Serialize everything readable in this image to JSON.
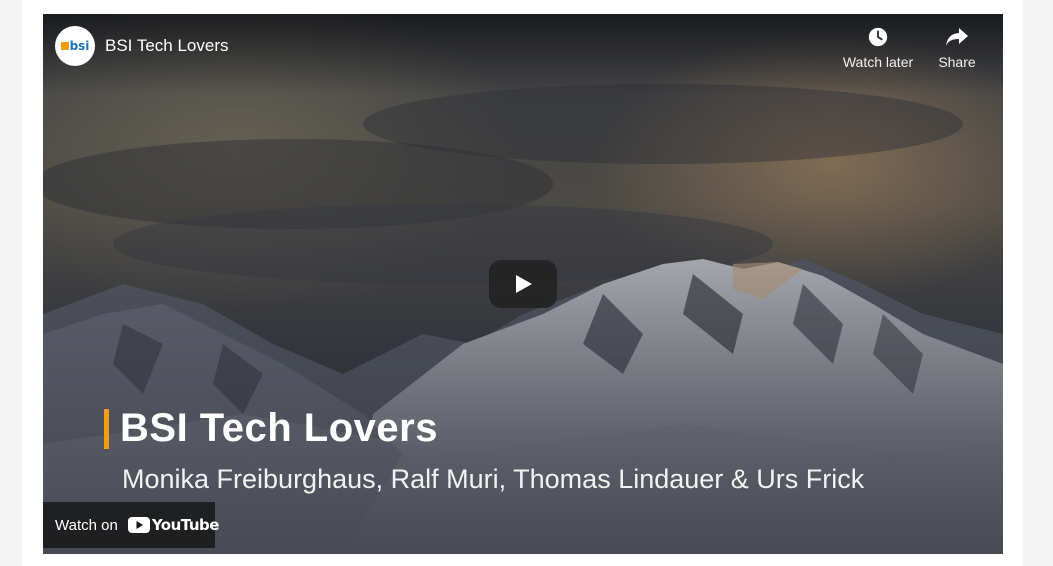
{
  "video": {
    "channel_avatar_text": "bsi",
    "title": "BSI Tech Lovers"
  },
  "top_actions": {
    "watch_later_label": "Watch later",
    "share_label": "Share"
  },
  "overlay": {
    "title": "BSI Tech Lovers",
    "subtitle": "Monika Freiburghaus, Ralf Muri, Thomas Lindauer & Urs Frick"
  },
  "footer": {
    "watch_on_label": "Watch on",
    "youtube_logo_text": "YouTube"
  },
  "colors": {
    "accent": "#f39c12",
    "brand_blue": "#1b75bc",
    "youtube_red": "#ff0000"
  },
  "icons": {
    "watch_later": "clock-icon",
    "share": "share-arrow-icon",
    "play": "play-icon"
  }
}
